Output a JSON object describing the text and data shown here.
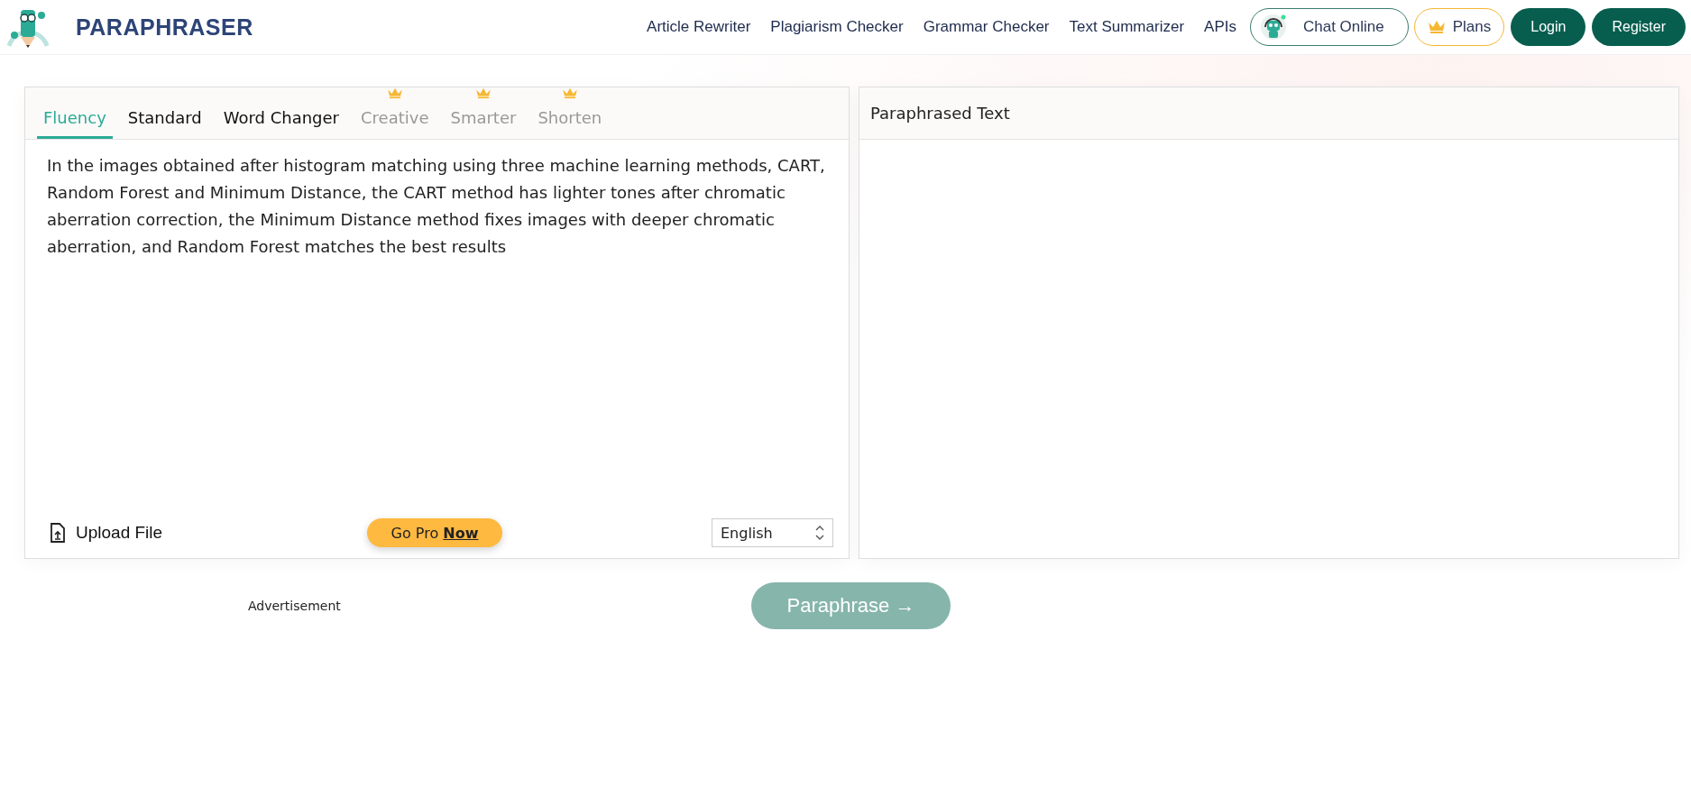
{
  "header": {
    "brand": "PARAPHRASER",
    "nav": [
      "Article Rewriter",
      "Plagiarism Checker",
      "Grammar Checker",
      "Text Summarizer",
      "APIs"
    ],
    "chat_button": "Chat Online",
    "plans_button": "Plans",
    "login_button": "Login",
    "register_button": "Register"
  },
  "input_panel": {
    "tabs": [
      {
        "label": "Fluency",
        "selected": true,
        "premium": false
      },
      {
        "label": "Standard",
        "selected": false,
        "premium": false
      },
      {
        "label": "Word Changer",
        "selected": false,
        "premium": false
      },
      {
        "label": "Creative",
        "selected": false,
        "premium": true
      },
      {
        "label": "Smarter",
        "selected": false,
        "premium": true
      },
      {
        "label": "Shorten",
        "selected": false,
        "premium": true
      }
    ],
    "text": "In the images obtained after histogram matching using three machine learning methods, CART, Random Forest and Minimum Distance, the CART method has lighter tones after chromatic aberration correction, the Minimum Distance method fixes images with deeper chromatic aberration, and Random Forest matches the best results",
    "upload_button": "Upload File",
    "go_pro_button": "Go Pro **Now**",
    "language": "English"
  },
  "output_panel": {
    "title": "Paraphrased Text"
  },
  "advertisement": "Advertisement",
  "paraphrase_button": {
    "label": "Paraphrase →",
    "disabled": true
  }
}
